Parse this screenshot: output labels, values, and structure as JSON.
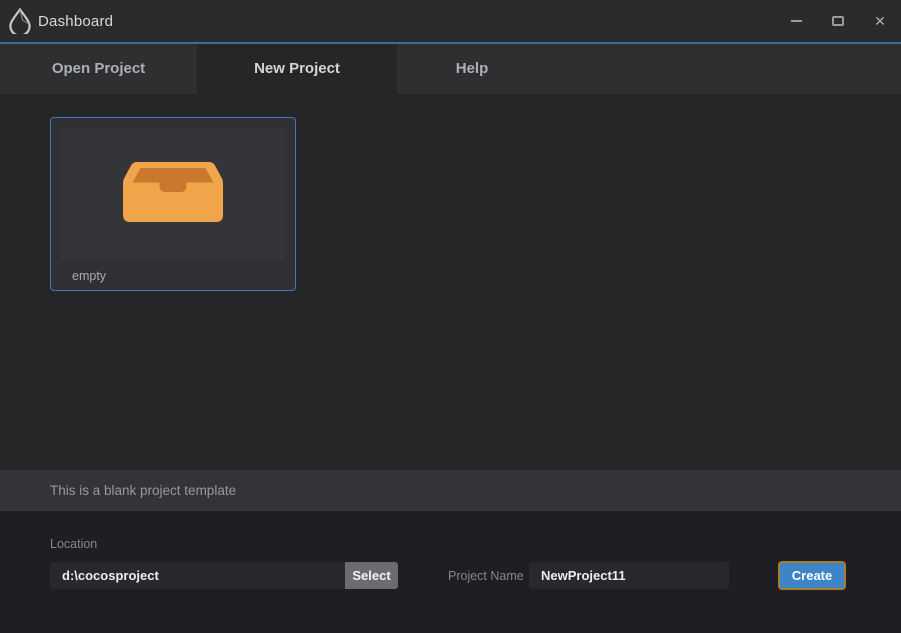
{
  "window": {
    "title": "Dashboard",
    "close_glyph": "✕"
  },
  "tabs": [
    {
      "label": "Open Project",
      "active": false
    },
    {
      "label": "New Project",
      "active": true
    },
    {
      "label": "Help",
      "active": false
    }
  ],
  "template_card": {
    "label": "empty",
    "icon": "inbox-tray-icon"
  },
  "status": {
    "text": "This is a blank project template"
  },
  "footer": {
    "location_label": "Location",
    "location_value": "d:\\cocosproject",
    "select_label": "Select",
    "project_name_label": "Project Name",
    "project_name_value": "NewProject11",
    "create_label": "Create"
  },
  "colors": {
    "accent_line": "#3d6c94",
    "card_border": "#3f7ab2",
    "create_button": "#3d85c7",
    "create_button_border": "#a97b2d",
    "icon_orange": "#f1a54b",
    "icon_orange_dark": "#c9782e"
  }
}
